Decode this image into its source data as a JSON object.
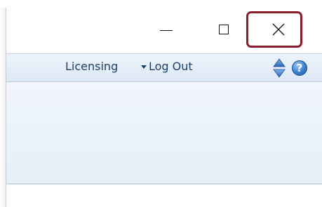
{
  "window": {
    "caption_buttons": {
      "minimize_icon": "minimize-icon",
      "maximize_icon": "maximize-icon",
      "close_icon": "close-icon",
      "close_glyph": "✕",
      "highlight_color": "#8a1c2b"
    }
  },
  "toolbar": {
    "licensing_label": "Licensing",
    "dropdown_icon": "caret-down-icon",
    "logout_label": "Log Out",
    "expand_collapse_icon": "up-down-arrows-icon",
    "help_icon": "help-icon",
    "help_glyph": "?"
  },
  "colors": {
    "toolbar_text": "#1e3f66",
    "toolbar_bg": "#dde8f5",
    "content_bg": "#e6eef8"
  }
}
